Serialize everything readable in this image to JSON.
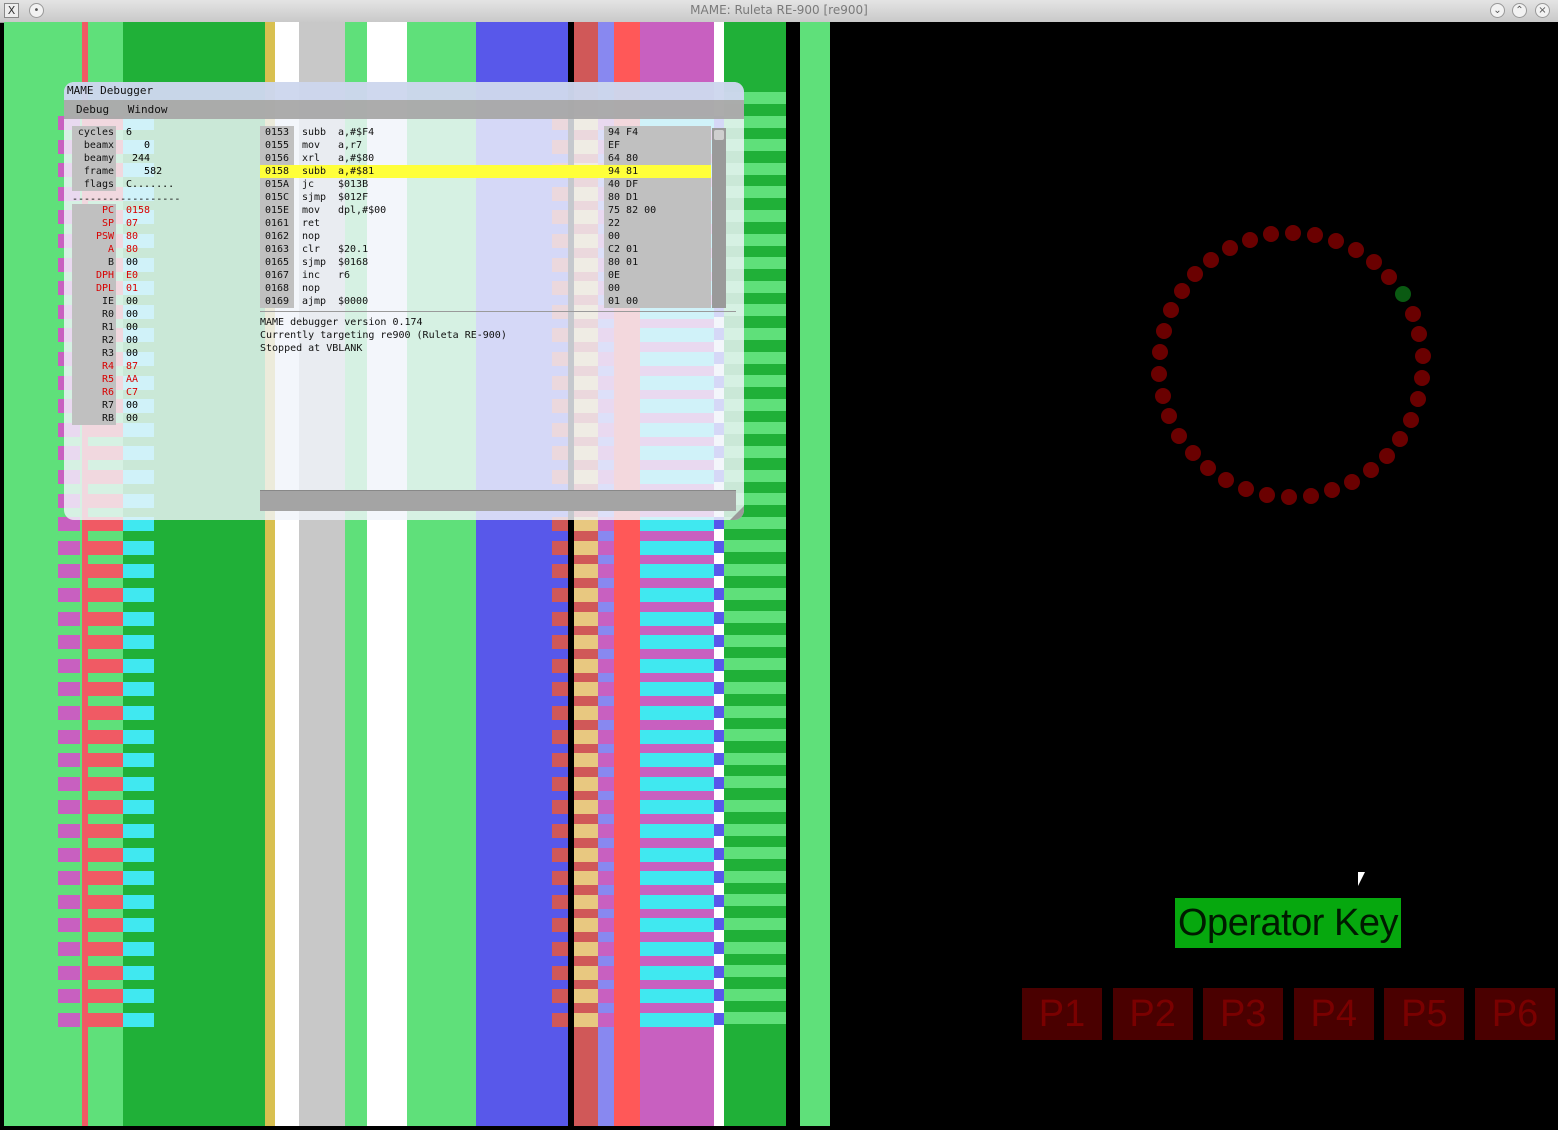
{
  "window": {
    "title": "MAME: Ruleta RE-900 [re900]",
    "app_icon_glyph": "X",
    "menu_glyph": "•",
    "minimize_glyph": "⌄",
    "maximize_glyph": "⌃",
    "close_glyph": "×"
  },
  "debugger": {
    "title": "MAME Debugger",
    "menu": [
      "Debug",
      "Window"
    ],
    "registers_top": [
      {
        "name": "cycles",
        "value": "6"
      },
      {
        "name": "beamx",
        "value": "   0"
      },
      {
        "name": "beamy",
        "value": " 244"
      },
      {
        "name": "frame",
        "value": "   582"
      },
      {
        "name": "flags",
        "value": "C......."
      }
    ],
    "separator": "------------------",
    "registers": [
      {
        "name": "PC",
        "value": "0158",
        "changed": true
      },
      {
        "name": "SP",
        "value": "07",
        "changed": true
      },
      {
        "name": "PSW",
        "value": "80",
        "changed": true
      },
      {
        "name": "A",
        "value": "80",
        "changed": true
      },
      {
        "name": "B",
        "value": "00",
        "changed": false
      },
      {
        "name": "DPH",
        "value": "E0",
        "changed": true
      },
      {
        "name": "DPL",
        "value": "01",
        "changed": true
      },
      {
        "name": "IE",
        "value": "00",
        "changed": false
      },
      {
        "name": "R0",
        "value": "00",
        "changed": false
      },
      {
        "name": "R1",
        "value": "00",
        "changed": false
      },
      {
        "name": "R2",
        "value": "00",
        "changed": false
      },
      {
        "name": "R3",
        "value": "00",
        "changed": false
      },
      {
        "name": "R4",
        "value": "87",
        "changed": true
      },
      {
        "name": "R5",
        "value": "AA",
        "changed": true
      },
      {
        "name": "R6",
        "value": "C7",
        "changed": true
      },
      {
        "name": "R7",
        "value": "00",
        "changed": false
      },
      {
        "name": "RB",
        "value": "00",
        "changed": false
      }
    ],
    "disassembly": [
      {
        "addr": "0153",
        "mnem": "subb",
        "ops": "a,#$F4",
        "bytes": "94 F4"
      },
      {
        "addr": "0155",
        "mnem": "mov",
        "ops": "a,r7",
        "bytes": "EF"
      },
      {
        "addr": "0156",
        "mnem": "xrl",
        "ops": "a,#$80",
        "bytes": "64 80"
      },
      {
        "addr": "0158",
        "mnem": "subb",
        "ops": "a,#$81",
        "bytes": "94 81",
        "current": true
      },
      {
        "addr": "015A",
        "mnem": "jc",
        "ops": "$013B",
        "bytes": "40 DF"
      },
      {
        "addr": "015C",
        "mnem": "sjmp",
        "ops": "$012F",
        "bytes": "80 D1"
      },
      {
        "addr": "015E",
        "mnem": "mov",
        "ops": "dpl,#$00",
        "bytes": "75 82 00"
      },
      {
        "addr": "0161",
        "mnem": "ret",
        "ops": "",
        "bytes": "22"
      },
      {
        "addr": "0162",
        "mnem": "nop",
        "ops": "",
        "bytes": "00"
      },
      {
        "addr": "0163",
        "mnem": "clr",
        "ops": "$20.1",
        "bytes": "C2 01"
      },
      {
        "addr": "0165",
        "mnem": "sjmp",
        "ops": "$0168",
        "bytes": "80 01"
      },
      {
        "addr": "0167",
        "mnem": "inc",
        "ops": "r6",
        "bytes": "0E"
      },
      {
        "addr": "0168",
        "mnem": "nop",
        "ops": "",
        "bytes": "00"
      },
      {
        "addr": "0169",
        "mnem": "ajmp",
        "ops": "$0000",
        "bytes": "01 00"
      }
    ],
    "console": [
      "MAME debugger version 0.174",
      "Currently targeting re900 (Ruleta RE-900)",
      "Stopped at VBLANK"
    ]
  },
  "game": {
    "operator_key_label": "Operator Key",
    "player_buttons": [
      "P1",
      "P2",
      "P3",
      "P4",
      "P5",
      "P6"
    ],
    "wheel": {
      "led_count": 38,
      "lit_led_index": 5
    },
    "colors": {
      "led_off": "#6a0000",
      "led_on": "#0a5a12",
      "operator_key": "#06a80e",
      "player_button": "#4a0000"
    }
  }
}
